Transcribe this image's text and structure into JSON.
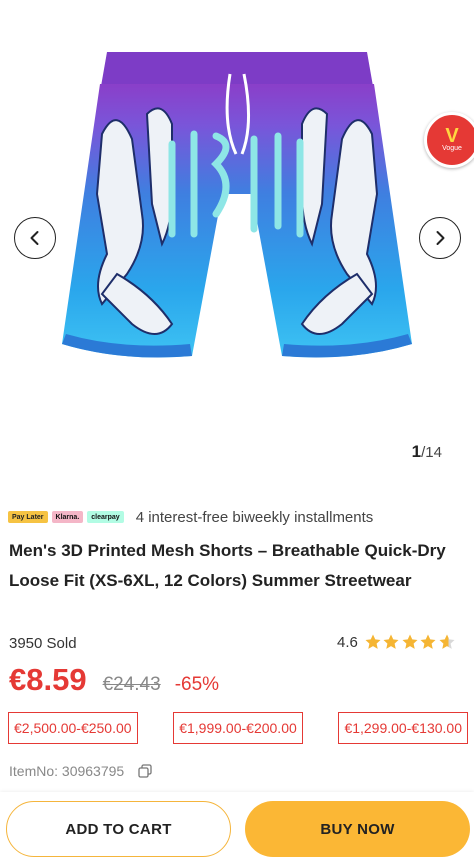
{
  "gallery": {
    "current": "1",
    "total": "/14",
    "badge_text": "V",
    "badge_sub": "Vogue"
  },
  "payment": {
    "logos": [
      "Pay Later",
      "Klarna.",
      "clearpay"
    ],
    "text": "4 interest-free biweekly installments"
  },
  "product": {
    "title": "Men's 3D Printed Mesh Shorts – Breathable Quick-Dry Loose Fit (XS-6XL, 12 Colors) Summer Streetwear",
    "sold": "3950 Sold",
    "rating": "4.6",
    "rating_fraction": 0.92,
    "price": "€8.59",
    "original_price": "€24.43",
    "discount": "-65%",
    "tiers": [
      "€2,500.00-€250.00",
      "€1,999.00-€200.00",
      "€1,299.00-€130.00"
    ],
    "item_no": "ItemNo: 30963795"
  },
  "actions": {
    "add_to_cart": "ADD TO CART",
    "buy_now": "BUY NOW"
  },
  "colors": {
    "accent_red": "#e53935",
    "button_yellow": "#fbb735",
    "star": "#f5b533"
  }
}
